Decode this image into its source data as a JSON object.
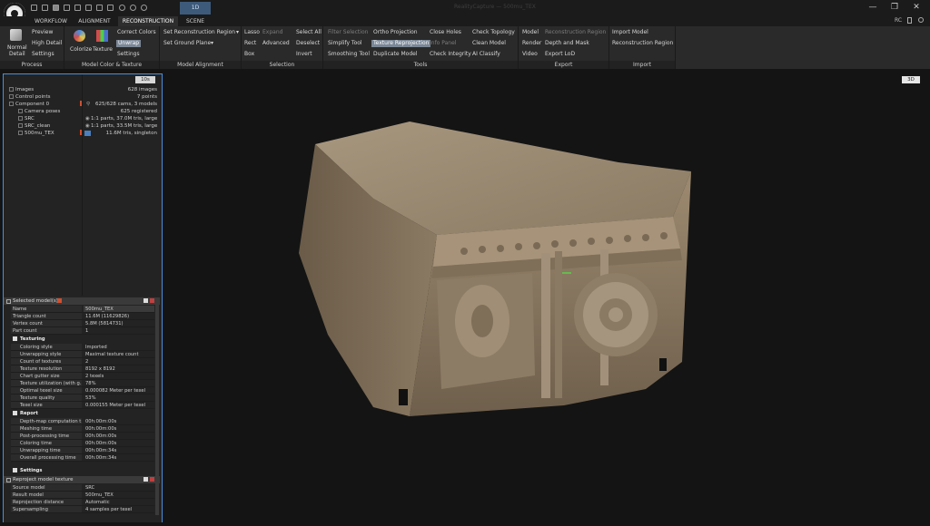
{
  "window": {
    "title": "RealityCapture — 500mu_TEX",
    "tab_label": "1D",
    "min_glyph": "—",
    "max_glyph": "❐",
    "close_glyph": "✕",
    "extra_icons": [
      "document-icon",
      "help-icon"
    ],
    "rc_label": "RC"
  },
  "menu_tabs": [
    "WORKFLOW",
    "ALIGNMENT",
    "RECONSTRUCTION",
    "SCENE"
  ],
  "active_tab": "RECONSTRUCTION",
  "ribbon": {
    "process": {
      "title": "Process",
      "normal": "Normal",
      "detail": "Detail",
      "preview": "Preview",
      "high_detail": "High Detail",
      "settings": "Settings"
    },
    "color": {
      "title": "Model Color & Texture",
      "colorize": "Colorize",
      "texture": "Texture",
      "correct": "Correct Colors",
      "unwrap": "Unwrap",
      "settings": "Settings"
    },
    "alignment": {
      "title": "Model Alignment",
      "set_region": "Set Reconstruction Region",
      "set_ground": "Set Ground Plane"
    },
    "selection": {
      "title": "Selection",
      "lasso": "Lasso",
      "expand": "Expand",
      "select_all": "Select All",
      "rect": "Rect",
      "advanced": "Advanced",
      "deselect": "Deselect",
      "box": "Box",
      "invert": "Invert"
    },
    "tools": {
      "title": "Tools",
      "filter": "Filter Selection",
      "ortho": "Ortho Projection",
      "close_holes": "Close Holes",
      "check_topology": "Check Topology",
      "simplify": "Simplify Tool",
      "reprojection": "Texture Reprojection",
      "info_panel": "Info Panel",
      "clean_model": "Clean Model",
      "smoothing": "Smoothing Tool",
      "duplicate": "Duplicate Model",
      "check_integrity": "Check Integrity",
      "ai_classify": "AI Classify"
    },
    "export": {
      "title": "Export",
      "model": "Model",
      "recon_region": "Reconstruction Region",
      "render": "Render",
      "depth_mask": "Depth and Mask",
      "video": "Video",
      "export_lod": "Export LoD"
    },
    "import": {
      "title": "Import",
      "import_model": "Import Model",
      "recon_region": "Reconstruction Region"
    }
  },
  "tree": {
    "btn_10s": "10s",
    "items": [
      {
        "label": "Images",
        "value": "628 images"
      },
      {
        "label": "Control points",
        "value": "7 points"
      },
      {
        "label": "Component 0",
        "value": "625/628 cams, 3 models"
      },
      {
        "label": "Camera poses",
        "value": "625 registered"
      },
      {
        "label": "SRC",
        "value": "1:1 parts, 37.0M tris, large"
      },
      {
        "label": "SRC_clean",
        "value": "1:1 parts, 33.5M tris, large"
      },
      {
        "label": "500mu_TEX",
        "value": "11.6M tris, singleton"
      }
    ]
  },
  "selected_model": {
    "header": "Selected model(s)",
    "rows": [
      {
        "k": "Name",
        "v": "500mu_TEX"
      },
      {
        "k": "Triangle count",
        "v": "11.6M (11629826)"
      },
      {
        "k": "Vertex count",
        "v": "5.8M (5814731)"
      },
      {
        "k": "Part count",
        "v": "1"
      }
    ],
    "texturing_label": "Texturing",
    "texturing": [
      {
        "k": "Coloring style",
        "v": "Imported"
      },
      {
        "k": "Unwrapping style",
        "v": "Maximal texture count"
      },
      {
        "k": "Count of textures",
        "v": "2"
      },
      {
        "k": "Texture resolution",
        "v": "8192 x 8192"
      },
      {
        "k": "Chart gutter size",
        "v": "2 texels"
      },
      {
        "k": "Texture utilization (with g...",
        "v": "78%"
      },
      {
        "k": "Optimal texel size",
        "v": "0.000082 Meter per texel"
      },
      {
        "k": "Texture quality",
        "v": "53%"
      },
      {
        "k": "Texel size",
        "v": "0.000155 Meter per texel"
      }
    ],
    "report_label": "Report",
    "report": [
      {
        "k": "Depth-map computation t...",
        "v": "00h:00m:00s"
      },
      {
        "k": "Meshing time",
        "v": "00h:00m:00s"
      },
      {
        "k": "Post-processing time",
        "v": "00h:00m:00s"
      },
      {
        "k": "Coloring time",
        "v": "00h:00m:00s"
      },
      {
        "k": "Unwrapping time",
        "v": "00h:00m:34s"
      },
      {
        "k": "Overall processing time",
        "v": "00h:00m:34s"
      }
    ],
    "settings_label": "Settings"
  },
  "reproject": {
    "header": "Reproject model texture",
    "rows": [
      {
        "k": "Source model",
        "v": "SRC"
      },
      {
        "k": "Result model",
        "v": "500mu_TEX"
      },
      {
        "k": "Reprojection distance",
        "v": "Automatic"
      },
      {
        "k": "Supersampling",
        "v": "4 samples per texel"
      }
    ]
  },
  "viewport": {
    "mode_label": "3D"
  }
}
